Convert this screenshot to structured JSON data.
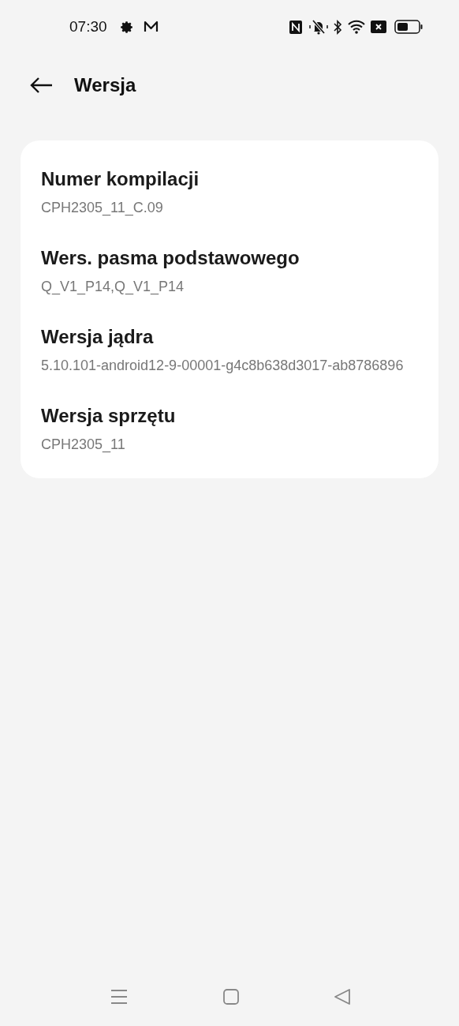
{
  "status_bar": {
    "time": "07:30"
  },
  "header": {
    "title": "Wersja"
  },
  "items": [
    {
      "title": "Numer kompilacji",
      "value": "CPH2305_11_C.09"
    },
    {
      "title": "Wers. pasma podstawowego",
      "value": "Q_V1_P14,Q_V1_P14"
    },
    {
      "title": "Wersja jądra",
      "value": "5.10.101-android12-9-00001-g4c8b638d3017-ab8786896"
    },
    {
      "title": "Wersja sprzętu",
      "value": "CPH2305_11"
    }
  ]
}
